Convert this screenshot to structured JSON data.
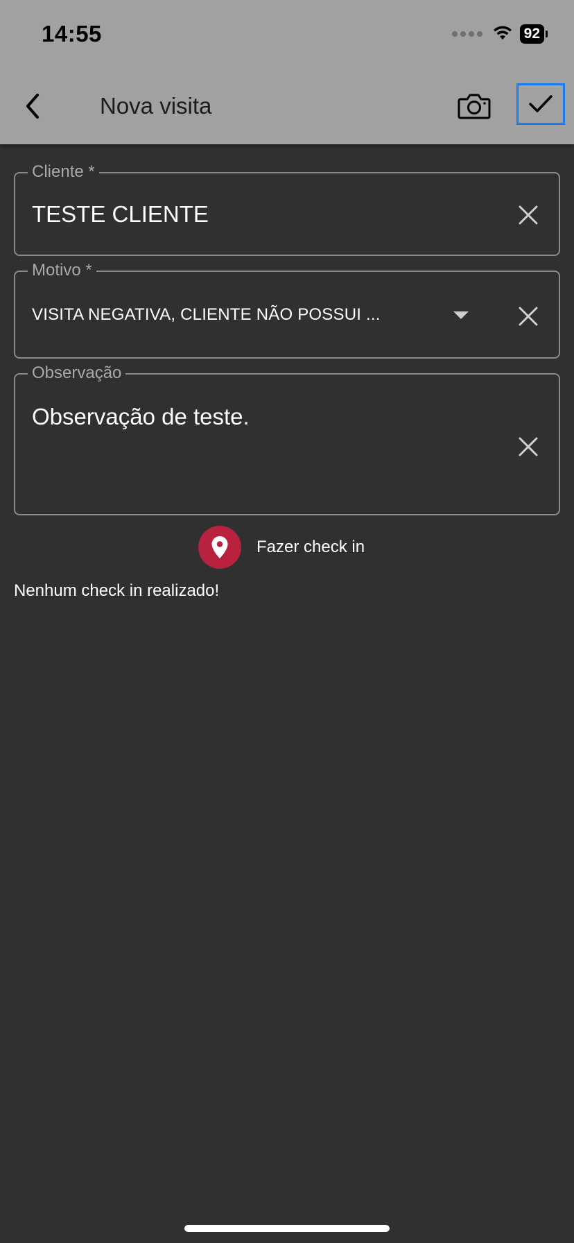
{
  "status_bar": {
    "time": "14:55",
    "battery": "92"
  },
  "app_bar": {
    "title": "Nova visita",
    "back_icon": "chevron-left-icon",
    "camera_icon": "camera-icon",
    "confirm_icon": "check-icon"
  },
  "form": {
    "cliente": {
      "label": "Cliente *",
      "value": "TESTE CLIENTE"
    },
    "motivo": {
      "label": "Motivo *",
      "value": "VISITA NEGATIVA, CLIENTE NÃO POSSUI ..."
    },
    "observacao": {
      "label": "Observação",
      "value": "Observação de teste."
    }
  },
  "checkin": {
    "button_label": "Fazer check in",
    "status_text": "Nenhum check in realizado!"
  },
  "colors": {
    "header_bg": "#a1a1a1",
    "page_bg": "#303030",
    "checkin_accent": "#b8223f",
    "focus_outline": "#1b7df2"
  }
}
